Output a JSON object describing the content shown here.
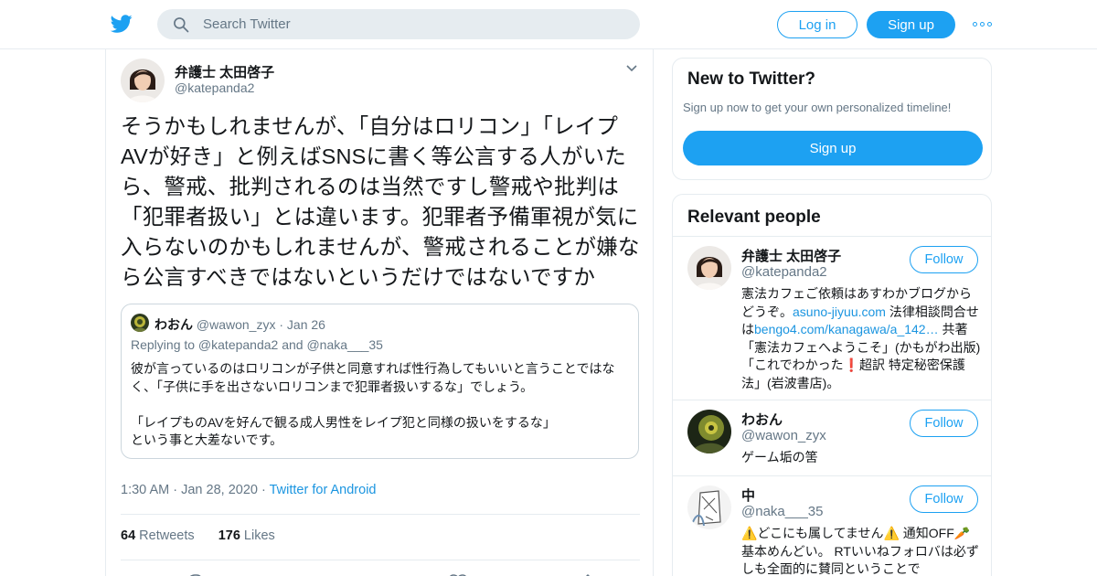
{
  "header": {
    "logo_icon": "twitter-bird-icon",
    "search_placeholder": "Search Twitter",
    "login_label": "Log in",
    "signup_label": "Sign up",
    "more_icon": "more-dots-icon",
    "accent_color": "#1da1f2"
  },
  "tweet": {
    "author_name": "弁護士 太田啓子",
    "author_handle": "@katepanda2",
    "text": "そうかもしれませんが、「自分はロリコン」「レイプAVが好き」と例えばSNSに書く等公言する人がいたら、警戒、批判されるのは当然ですし警戒や批判は「犯罪者扱い」とは違います。犯罪者予備軍視が気に入らないのかもしれませんが、警戒されることが嫌なら公言すべきではないというだけではないですか",
    "quote": {
      "author_name": "わおん",
      "author_handle": "@wawon_zyx",
      "separator": "·",
      "date": "Jan 26",
      "replying_to": "Replying to @katepanda2 and @naka___35",
      "text": "彼が言っているのはロリコンが子供と同意すれば性行為してもいいと言うことではなく、「子供に手を出さないロリコンまで犯罪者扱いするな」でしょう。\n\n「レイプものAVを好んで観る成人男性をレイプ犯と同様の扱いをするな」\nという事と大差ないです。"
    },
    "time": "1:30 AM",
    "separator": "·",
    "date": "Jan 28, 2020",
    "source": "Twitter for Android",
    "retweets_count": "64",
    "retweets_label": "Retweets",
    "likes_count": "176",
    "likes_label": "Likes"
  },
  "sidebar": {
    "new_to_twitter": {
      "title": "New to Twitter?",
      "subtitle": "Sign up now to get your own personalized timeline!",
      "signup_label": "Sign up"
    },
    "relevant_people": {
      "title": "Relevant people",
      "follow_label": "Follow",
      "people": [
        {
          "name": "弁護士 太田啓子",
          "handle": "@katepanda2",
          "bio_1": "憲法カフェご依頼はあすわかブログからどうぞ。",
          "link_1": "asuno-jiyuu.com",
          "bio_2": " 法律相談問合せは",
          "link_2": "bengo4.com/kanagawa/a_142…",
          "bio_3": " 共著「憲法カフェへようこそ」(かもがわ出版)「これでわかった❗️超訳 特定秘密保護法」(岩波書店)。"
        },
        {
          "name": "わおん",
          "handle": "@wawon_zyx",
          "bio_1": "ゲーム垢の筈"
        },
        {
          "name": "中",
          "handle": "@naka___35",
          "bio_1": "⚠️どこにも属してません⚠️ 通知OFF🥕基本めんどい。 RTいいねフォロバは必ずしも全面的に賛同ということで"
        }
      ]
    }
  }
}
